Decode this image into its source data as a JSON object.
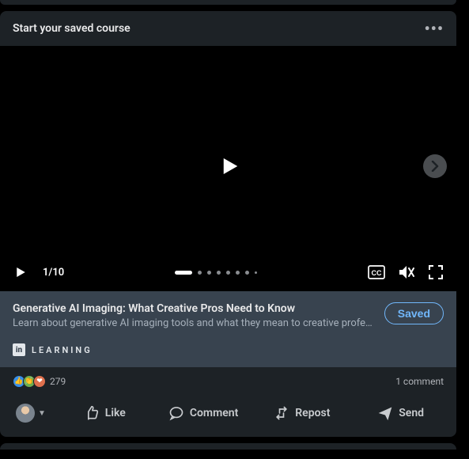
{
  "header": {
    "title": "Start your saved course"
  },
  "video": {
    "position": "1/10"
  },
  "info": {
    "title": "Generative AI Imaging: What Creative Pros Need to Know",
    "description": "Learn about generative AI imaging tools and what they mean to creative profes...",
    "saved_label": "Saved",
    "learning_label": "LEARNING",
    "in_badge": "in"
  },
  "stats": {
    "reaction_count": "279",
    "comments": "1 comment"
  },
  "actions": {
    "like": "Like",
    "comment": "Comment",
    "repost": "Repost",
    "send": "Send"
  }
}
